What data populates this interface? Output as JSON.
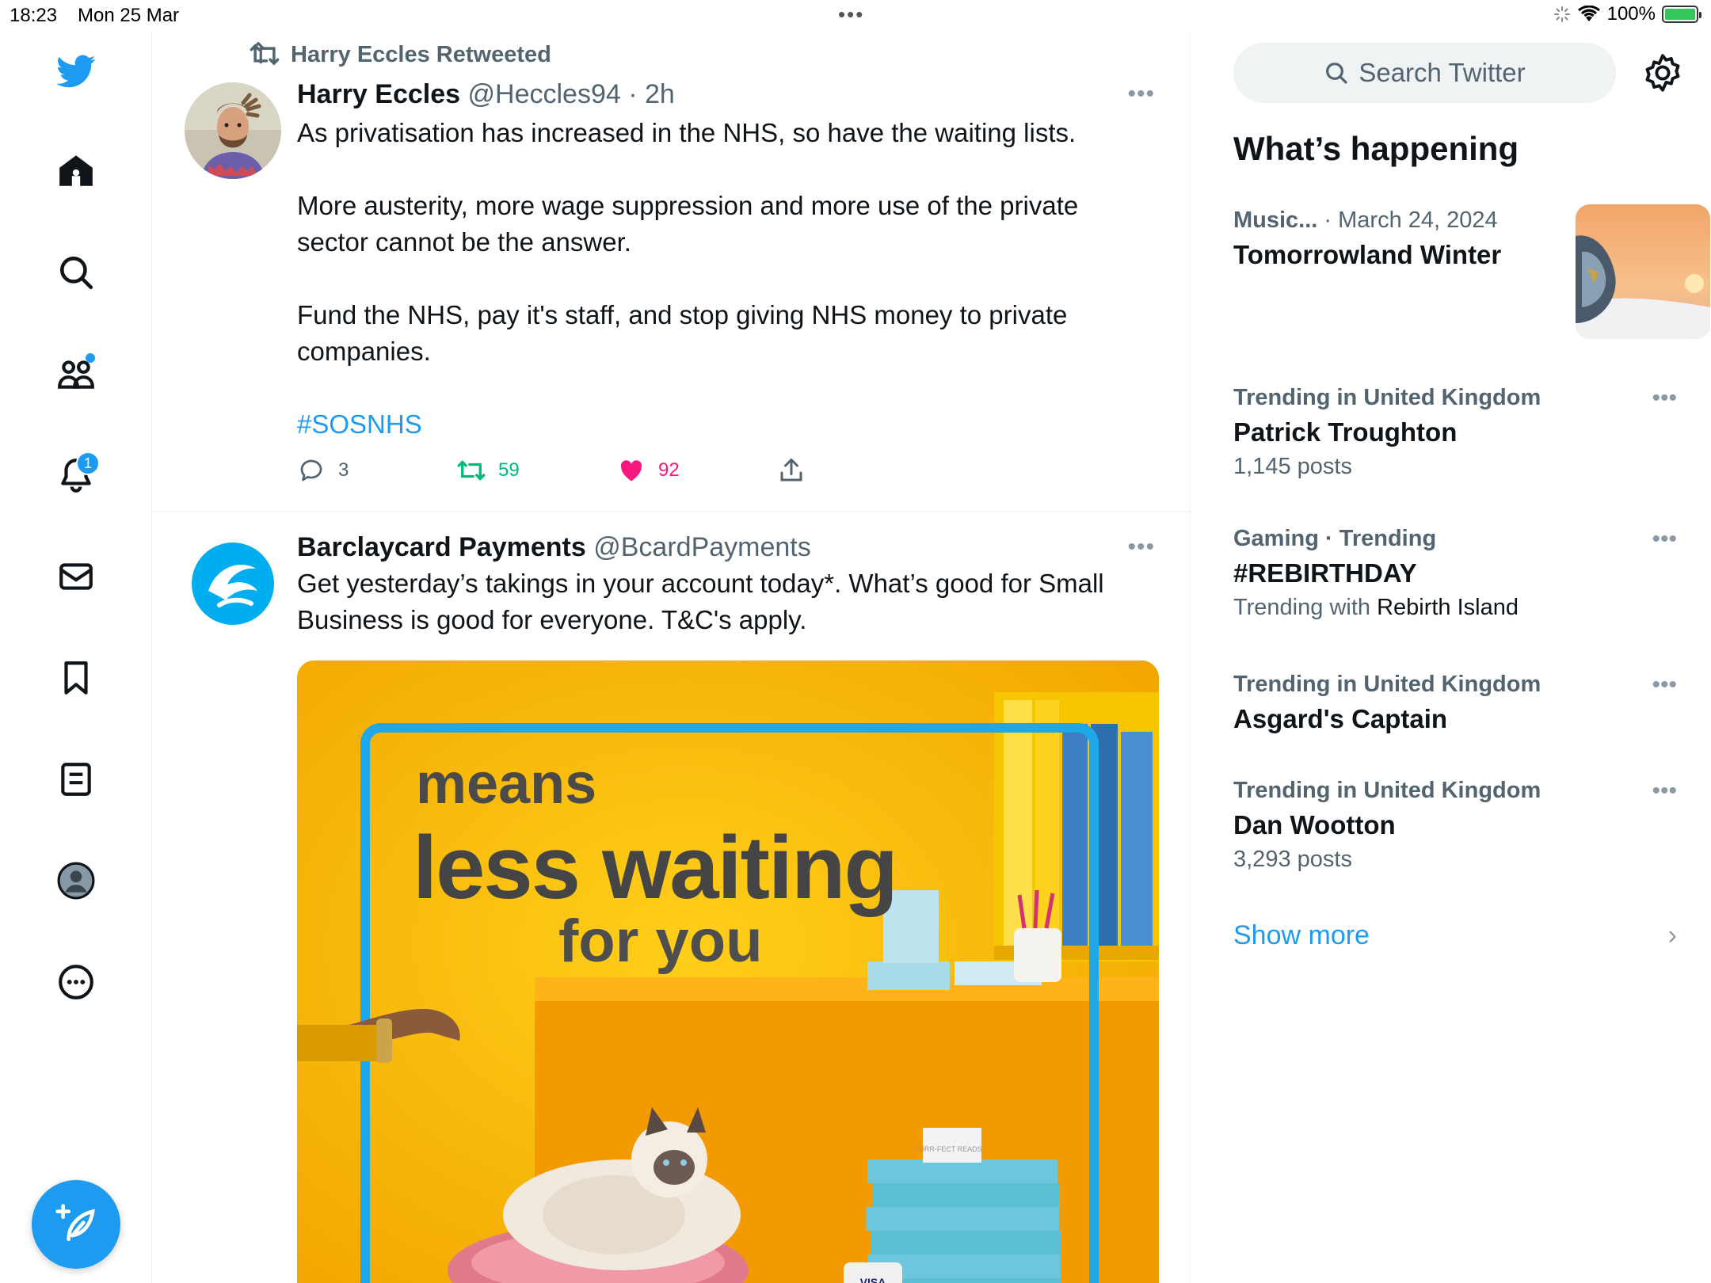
{
  "status_bar": {
    "time": "18:23",
    "date": "Mon 25 Mar",
    "battery": "100%",
    "multitask_dots": "•••"
  },
  "nav": {
    "notifications_badge": "1",
    "icons": [
      "twitter-logo-icon",
      "home-icon",
      "search-icon",
      "communities-icon",
      "notifications-icon",
      "messages-icon",
      "bookmarks-icon",
      "lists-icon",
      "profile-icon",
      "more-icon",
      "compose-icon"
    ]
  },
  "tweets": [
    {
      "retweeted_by": "Harry Eccles Retweeted",
      "name": "Harry Eccles",
      "handle": "@Heccles94",
      "time": " · 2h",
      "paragraphs": [
        "As privatisation has increased in the NHS, so have the waiting lists.",
        "More austerity, more wage suppression and more use of the private sector cannot be the answer.",
        "Fund the NHS, pay it's staff, and stop giving NHS money to private companies."
      ],
      "hashtag": "#SOSNHS",
      "replies": "3",
      "retweets": "59",
      "likes": "92",
      "more": "•••"
    },
    {
      "name": "Barclaycard Payments",
      "handle": "@BcardPayments",
      "text": "Get yesterday’s takings in your account today*. What’s good for Small Business is good for everyone. T&C's apply.",
      "more": "•••",
      "media": {
        "line1": "means",
        "line2": "less waiting",
        "line3": "for you",
        "box_label": "PURR-FECT READS",
        "card_label": "VISA"
      }
    }
  ],
  "sidebar": {
    "search_placeholder": "Search Twitter",
    "section_title": "What’s happening",
    "featured": {
      "category": "Music...",
      "date": " · March 24, 2024",
      "title": "Tomorrowland Winter"
    },
    "trends": [
      {
        "meta": "Trending in United Kingdom",
        "name": "Patrick Troughton",
        "sub": "1,145 posts"
      },
      {
        "meta": "Gaming · Trending",
        "name": "#REBIRTHDAY",
        "sub_prefix": "Trending with ",
        "sub_bold": "Rebirth Island"
      },
      {
        "meta": "Trending in United Kingdom",
        "name": "Asgard's Captain"
      },
      {
        "meta": "Trending in United Kingdom",
        "name": "Dan Wootton",
        "sub": "3,293 posts"
      }
    ],
    "trend_more": "•••",
    "show_more": "Show more",
    "show_more_chevron": "›"
  },
  "colors": {
    "accent": "#1d9bf0",
    "retweet": "#00ba7c",
    "like": "#f91880",
    "secondary_text": "#536471"
  }
}
